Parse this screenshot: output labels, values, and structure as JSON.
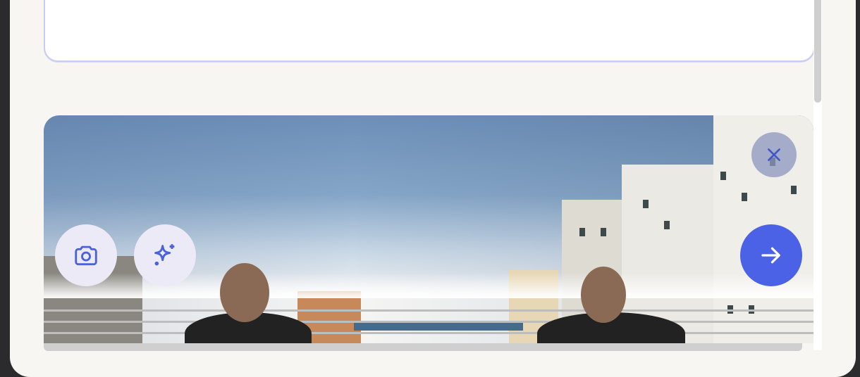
{
  "prompt_box": {
    "value": ""
  },
  "image_preview": {
    "description_icon": "uploaded-photo"
  },
  "actions": {
    "camera": {
      "icon": "camera-icon"
    },
    "sparkle": {
      "icon": "sparkle-icon"
    },
    "send": {
      "icon": "arrow-right-icon"
    },
    "remove_image": {
      "icon": "close-icon"
    }
  },
  "colors": {
    "accent": "#4b62e6",
    "button_bg": "#eceaf6",
    "icon_color": "#4a63d6",
    "panel_bg": "#f7f6f3"
  }
}
